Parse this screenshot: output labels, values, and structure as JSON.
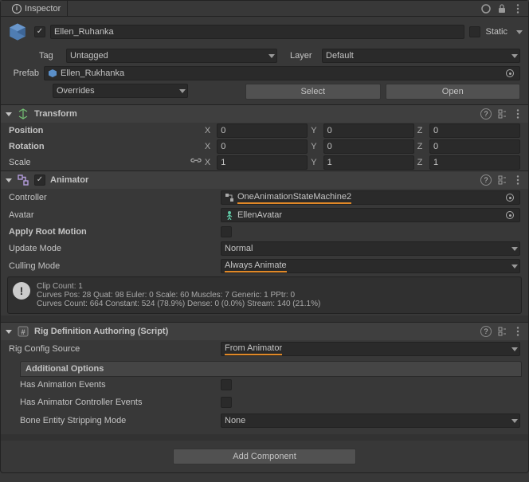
{
  "window": {
    "title": "Inspector"
  },
  "gameObject": {
    "name": "Ellen_Ruhanka",
    "active": true,
    "staticLabel": "Static",
    "static": false,
    "tagLabel": "Tag",
    "tagValue": "Untagged",
    "layerLabel": "Layer",
    "layerValue": "Default"
  },
  "prefab": {
    "label": "Prefab",
    "name": "Ellen_Rukhanka",
    "overridesLabel": "Overrides",
    "selectLabel": "Select",
    "openLabel": "Open"
  },
  "transform": {
    "title": "Transform",
    "positionLabel": "Position",
    "rotationLabel": "Rotation",
    "scaleLabel": "Scale",
    "position": {
      "x": "0",
      "y": "0",
      "z": "0"
    },
    "rotation": {
      "x": "0",
      "y": "0",
      "z": "0"
    },
    "scale": {
      "x": "1",
      "y": "1",
      "z": "1"
    }
  },
  "animator": {
    "title": "Animator",
    "enabled": true,
    "controllerLabel": "Controller",
    "controllerValue": "OneAnimationStateMachine2",
    "avatarLabel": "Avatar",
    "avatarValue": "EllenAvatar",
    "applyRootMotionLabel": "Apply Root Motion",
    "applyRootMotion": false,
    "updateModeLabel": "Update Mode",
    "updateModeValue": "Normal",
    "cullingModeLabel": "Culling Mode",
    "cullingModeValue": "Always Animate",
    "infoLine1": "Clip Count: 1",
    "infoLine2": "Curves Pos: 28 Quat: 98 Euler: 0 Scale: 60 Muscles: 7 Generic: 1 PPtr: 0",
    "infoLine3": "Curves Count: 664 Constant: 524 (78.9%) Dense: 0 (0.0%) Stream: 140 (21.1%)"
  },
  "rigDef": {
    "title": "Rig Definition Authoring (Script)",
    "rigConfigSourceLabel": "Rig Config Source",
    "rigConfigSourceValue": "From Animator",
    "additionalOptionsLabel": "Additional Options",
    "hasAnimationEventsLabel": "Has Animation Events",
    "hasAnimationEvents": false,
    "hasAnimatorControllerEventsLabel": "Has Animator Controller Events",
    "hasAnimatorControllerEvents": false,
    "boneEntityStrippingModeLabel": "Bone Entity Stripping Mode",
    "boneEntityStrippingModeValue": "None"
  },
  "addComponentLabel": "Add Component"
}
